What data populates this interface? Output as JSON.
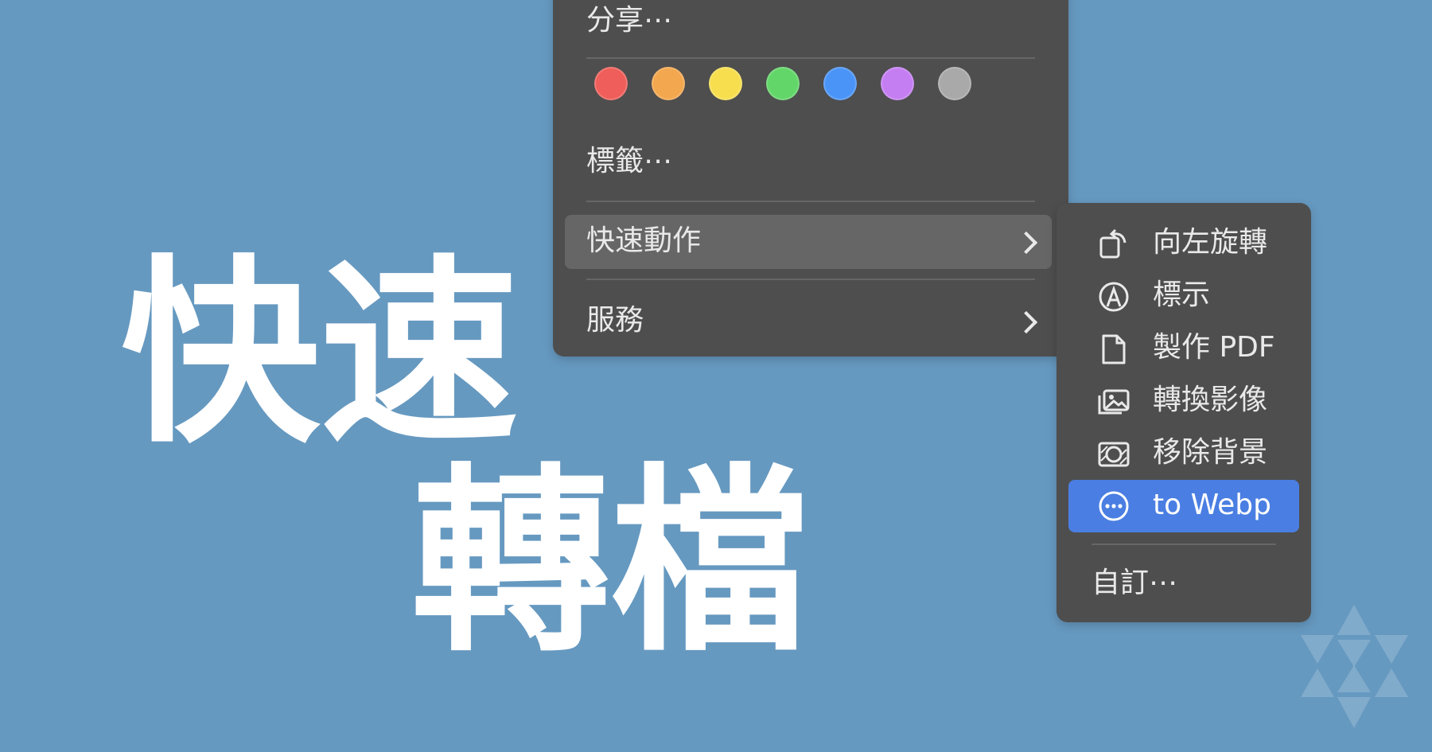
{
  "colors": {
    "background": "#6699c0",
    "menu_bg": "#4e4e4e",
    "highlight_blue": "#4a7ee2"
  },
  "hero": {
    "line1": "快速",
    "line2": "轉檔"
  },
  "context_menu": {
    "share_label": "分享⋯",
    "tag_colors": [
      {
        "name": "red",
        "color": "#ef5e5a"
      },
      {
        "name": "orange",
        "color": "#f3a74e"
      },
      {
        "name": "yellow",
        "color": "#f6de4f"
      },
      {
        "name": "green",
        "color": "#63d66a"
      },
      {
        "name": "blue",
        "color": "#4a94f7"
      },
      {
        "name": "purple",
        "color": "#c57ef2"
      },
      {
        "name": "gray",
        "color": "#a9a9a9"
      }
    ],
    "tags_label": "標籤⋯",
    "quick_actions_label": "快速動作",
    "services_label": "服務"
  },
  "quick_actions_submenu": {
    "items": [
      {
        "label": "向左旋轉",
        "icon": "rotate-left-icon"
      },
      {
        "label": "標示",
        "icon": "markup-icon"
      },
      {
        "label": "製作 PDF",
        "icon": "document-icon"
      },
      {
        "label": "轉換影像",
        "icon": "convert-image-icon"
      },
      {
        "label": "移除背景",
        "icon": "remove-background-icon"
      },
      {
        "label": "to Webp",
        "icon": "ellipsis-circle-icon",
        "selected": true
      }
    ],
    "customize_label": "自訂⋯"
  },
  "watermark": {
    "icon": "star-logo-icon"
  }
}
